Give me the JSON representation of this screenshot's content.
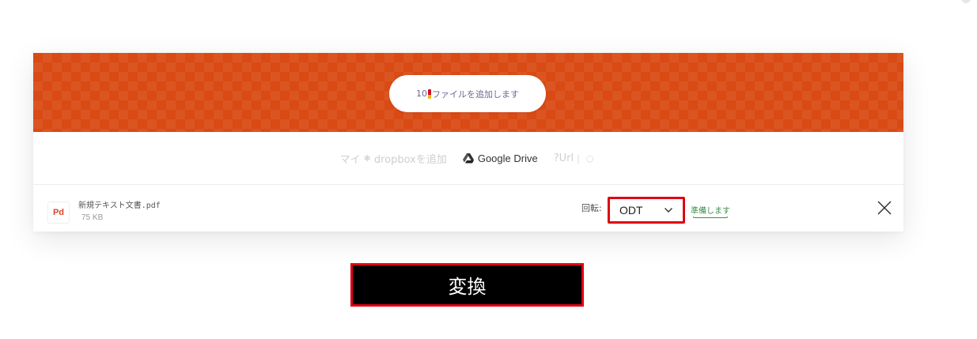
{
  "dropzone": {
    "add_files_prefix": "10",
    "add_files_label": "ファイルを追加します",
    "background_color": "#d94a14"
  },
  "sources": {
    "my_device_label": "マイ",
    "dropbox_label": "dropboxを追加",
    "google_drive_label": "Google Drive",
    "url_label": "?Url",
    "icons": [
      "star-icon",
      "google-drive-icon",
      "link-icon"
    ]
  },
  "file": {
    "type_badge": "Pd",
    "name": "新規テキスト文書.pdf",
    "size": "75 KB",
    "rotate_label": "回転:",
    "format_value": "ODT",
    "status": "準備します"
  },
  "actions": {
    "convert_label": "変換"
  },
  "colors": {
    "accent": "#d94a14",
    "highlight": "#e00012",
    "status": "#3c8f4e",
    "button_bg": "#000000"
  }
}
